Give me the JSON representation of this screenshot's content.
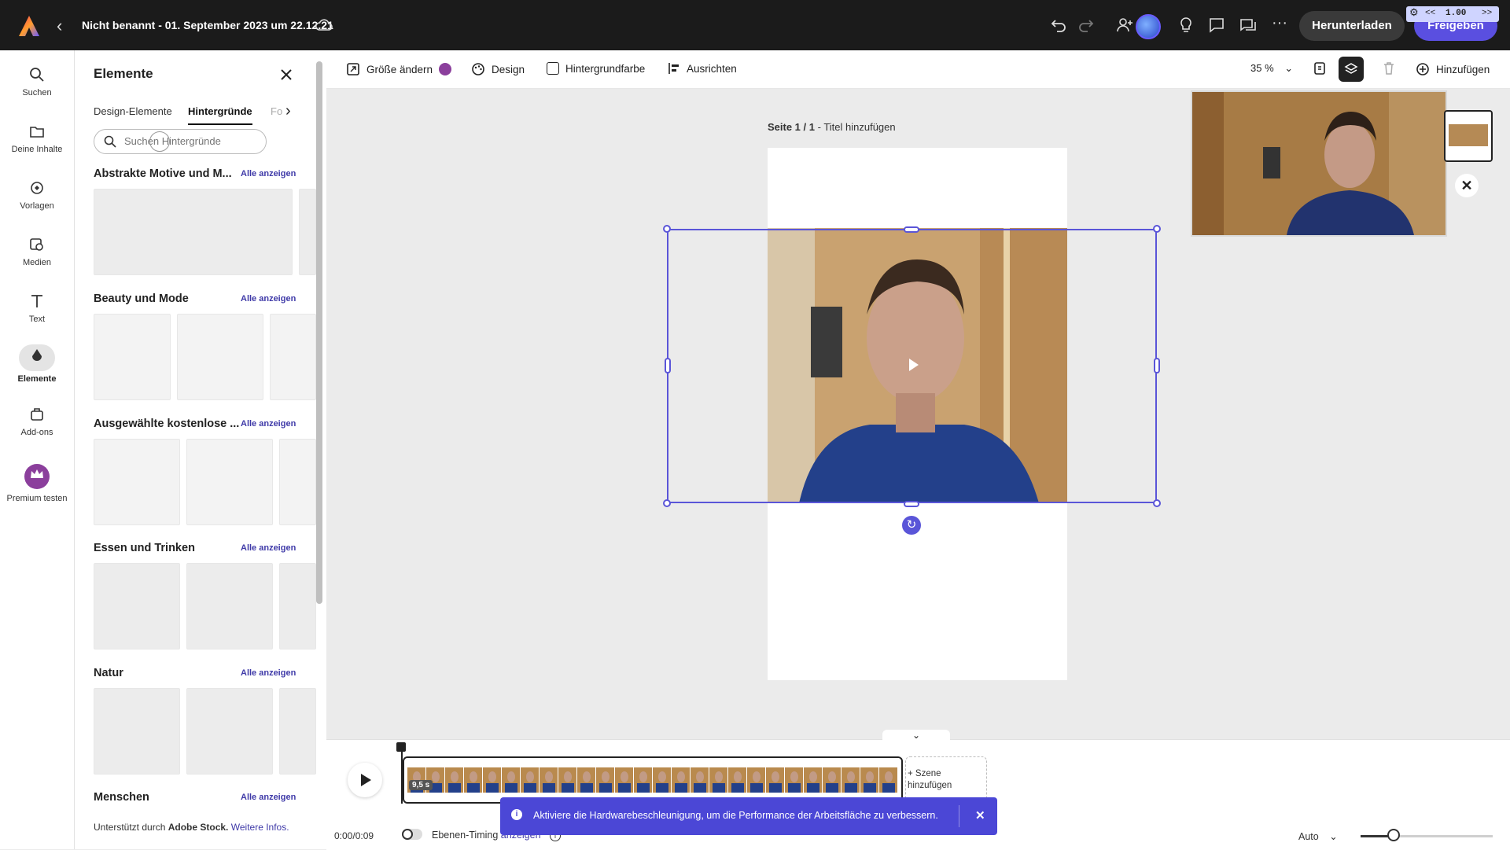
{
  "app": {
    "document_title": "Nicht benannt - 01. September 2023 um 22.12.21",
    "download_label": "Herunterladen",
    "share_label": "Freigeben",
    "speed": {
      "rewind": "<<",
      "value": "1.00",
      "forward": ">>"
    }
  },
  "leftnav": {
    "items": [
      {
        "label": "Suchen",
        "icon": "search-icon"
      },
      {
        "label": "Deine Inhalte",
        "icon": "folder-icon"
      },
      {
        "label": "Vorlagen",
        "icon": "templates-icon"
      },
      {
        "label": "Medien",
        "icon": "media-icon"
      },
      {
        "label": "Text",
        "icon": "text-icon"
      },
      {
        "label": "Elemente",
        "icon": "elements-icon",
        "active": true
      },
      {
        "label": "Add-ons",
        "icon": "addons-icon"
      },
      {
        "label": "Premium testen",
        "icon": "crown-icon"
      }
    ]
  },
  "panel": {
    "title": "Elemente",
    "tabs": [
      "Design-Elemente",
      "Hintergründe",
      "Fo"
    ],
    "active_tab": "Hintergründe",
    "search_placeholder": "Suchen Hintergründe",
    "sections": [
      {
        "title": "Abstrakte Motive und M...",
        "link": "Alle anzeigen"
      },
      {
        "title": "Beauty und Mode",
        "link": "Alle anzeigen"
      },
      {
        "title": "Ausgewählte kostenlose ...",
        "link": "Alle anzeigen"
      },
      {
        "title": "Essen und Trinken",
        "link": "Alle anzeigen"
      },
      {
        "title": "Natur",
        "link": "Alle anzeigen"
      },
      {
        "title": "Menschen",
        "link": "Alle anzeigen"
      }
    ],
    "footer_prefix": "Unterstützt durch",
    "footer_brand": "Adobe Stock.",
    "footer_link": "Weitere Infos."
  },
  "toolbar": {
    "resize": "Größe ändern",
    "design": "Design",
    "background_color": "Hintergrundfarbe",
    "align": "Ausrichten",
    "zoom": "35 %",
    "add": "Hinzufügen"
  },
  "canvas": {
    "page_prefix": "Seite 1 / 1",
    "page_title": "- Titel hinzufügen"
  },
  "timeline": {
    "clip_duration": "9,5 s",
    "add_scene": "+ Szene hinzufügen",
    "timecode": "0:00/0:09",
    "layer_timing": "Ebenen-Timing",
    "layer_timing_link": "anzeigen",
    "quality": "Auto",
    "zoom_level": 0.25
  },
  "toast": {
    "message": "Aktiviere die Hardwarebeschleunigung, um die Performance der Arbeitsfläche zu verbessern."
  },
  "colors": {
    "accent": "#5a4fe0",
    "selection": "#5a55d8",
    "topbar": "#1b1b1b"
  }
}
